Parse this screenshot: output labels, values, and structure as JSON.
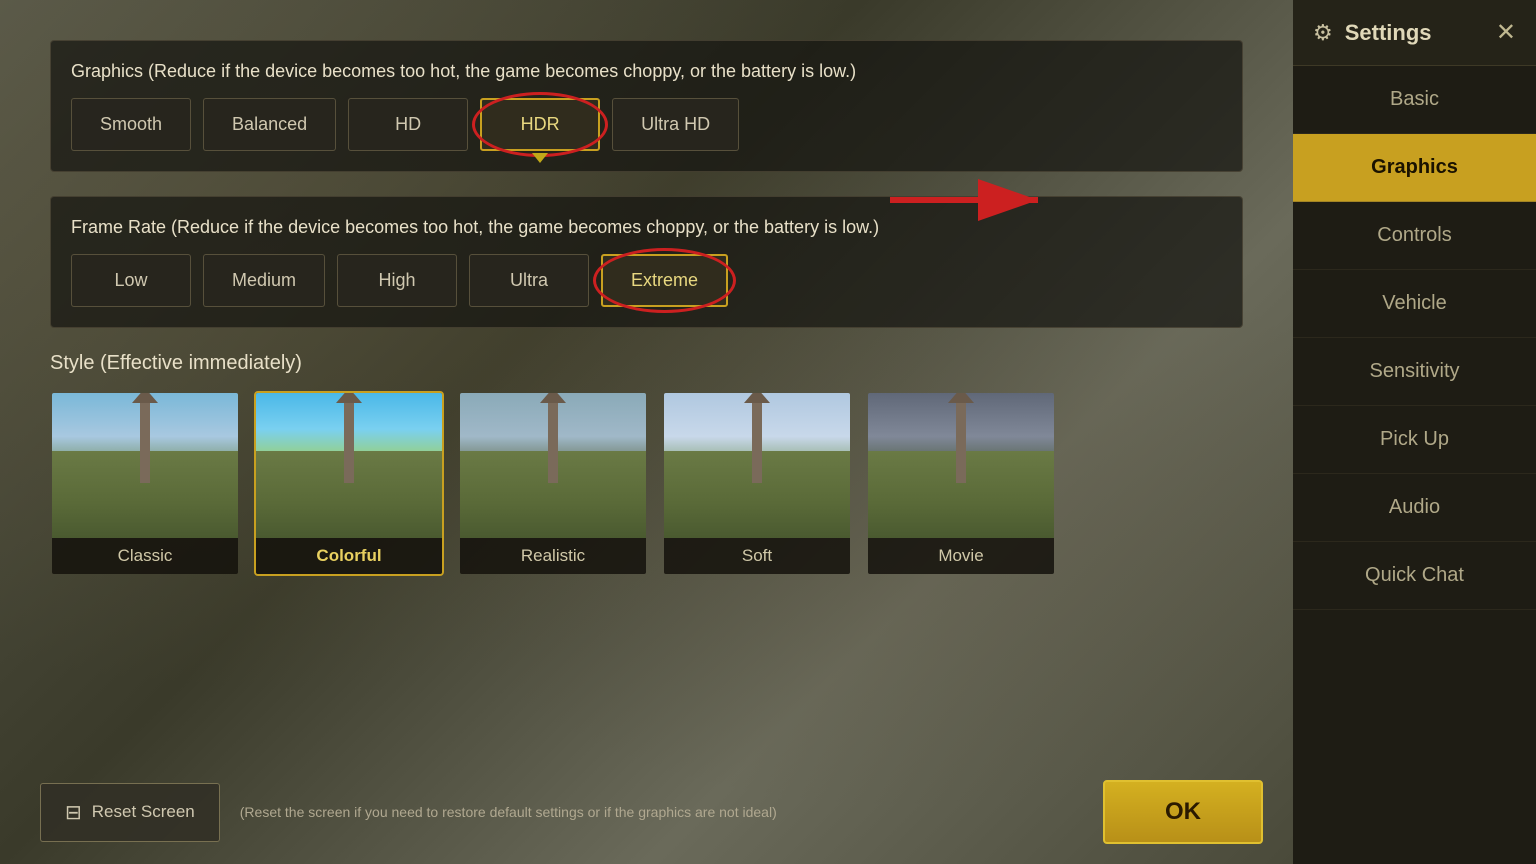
{
  "settings": {
    "title": "Settings",
    "close_label": "✕"
  },
  "graphics_section": {
    "label": "Graphics (Reduce if the device becomes too hot, the game becomes choppy, or the battery is low.)",
    "quality_options": [
      {
        "id": "smooth",
        "label": "Smooth",
        "selected": false
      },
      {
        "id": "balanced",
        "label": "Balanced",
        "selected": false
      },
      {
        "id": "hd",
        "label": "HD",
        "selected": false
      },
      {
        "id": "hdr",
        "label": "HDR",
        "selected": true
      },
      {
        "id": "ultra_hd",
        "label": "Ultra HD",
        "selected": false
      }
    ]
  },
  "frame_rate_section": {
    "label": "Frame Rate (Reduce if the device becomes too hot, the game becomes choppy, or the battery is low.)",
    "rate_options": [
      {
        "id": "low",
        "label": "Low",
        "selected": false
      },
      {
        "id": "medium",
        "label": "Medium",
        "selected": false
      },
      {
        "id": "high",
        "label": "High",
        "selected": false
      },
      {
        "id": "ultra",
        "label": "Ultra",
        "selected": false
      },
      {
        "id": "extreme",
        "label": "Extreme",
        "selected": true
      }
    ]
  },
  "style_section": {
    "title": "Style (Effective immediately)",
    "styles": [
      {
        "id": "classic",
        "label": "Classic",
        "selected": false
      },
      {
        "id": "colorful",
        "label": "Colorful",
        "selected": true
      },
      {
        "id": "realistic",
        "label": "Realistic",
        "selected": false
      },
      {
        "id": "soft",
        "label": "Soft",
        "selected": false
      },
      {
        "id": "movie",
        "label": "Movie",
        "selected": false
      }
    ]
  },
  "bottom": {
    "reset_label": "Reset Screen",
    "reset_icon": "⊟",
    "reset_desc": "(Reset the screen if you need to restore default settings or if the graphics are not ideal)",
    "ok_label": "OK"
  },
  "sidebar": {
    "nav_items": [
      {
        "id": "basic",
        "label": "Basic",
        "active": false
      },
      {
        "id": "graphics",
        "label": "Graphics",
        "active": true
      },
      {
        "id": "controls",
        "label": "Controls",
        "active": false
      },
      {
        "id": "vehicle",
        "label": "Vehicle",
        "active": false
      },
      {
        "id": "sensitivity",
        "label": "Sensitivity",
        "active": false
      },
      {
        "id": "pickup",
        "label": "Pick Up",
        "active": false
      },
      {
        "id": "audio",
        "label": "Audio",
        "active": false
      },
      {
        "id": "quickchat",
        "label": "Quick Chat",
        "active": false
      }
    ]
  }
}
